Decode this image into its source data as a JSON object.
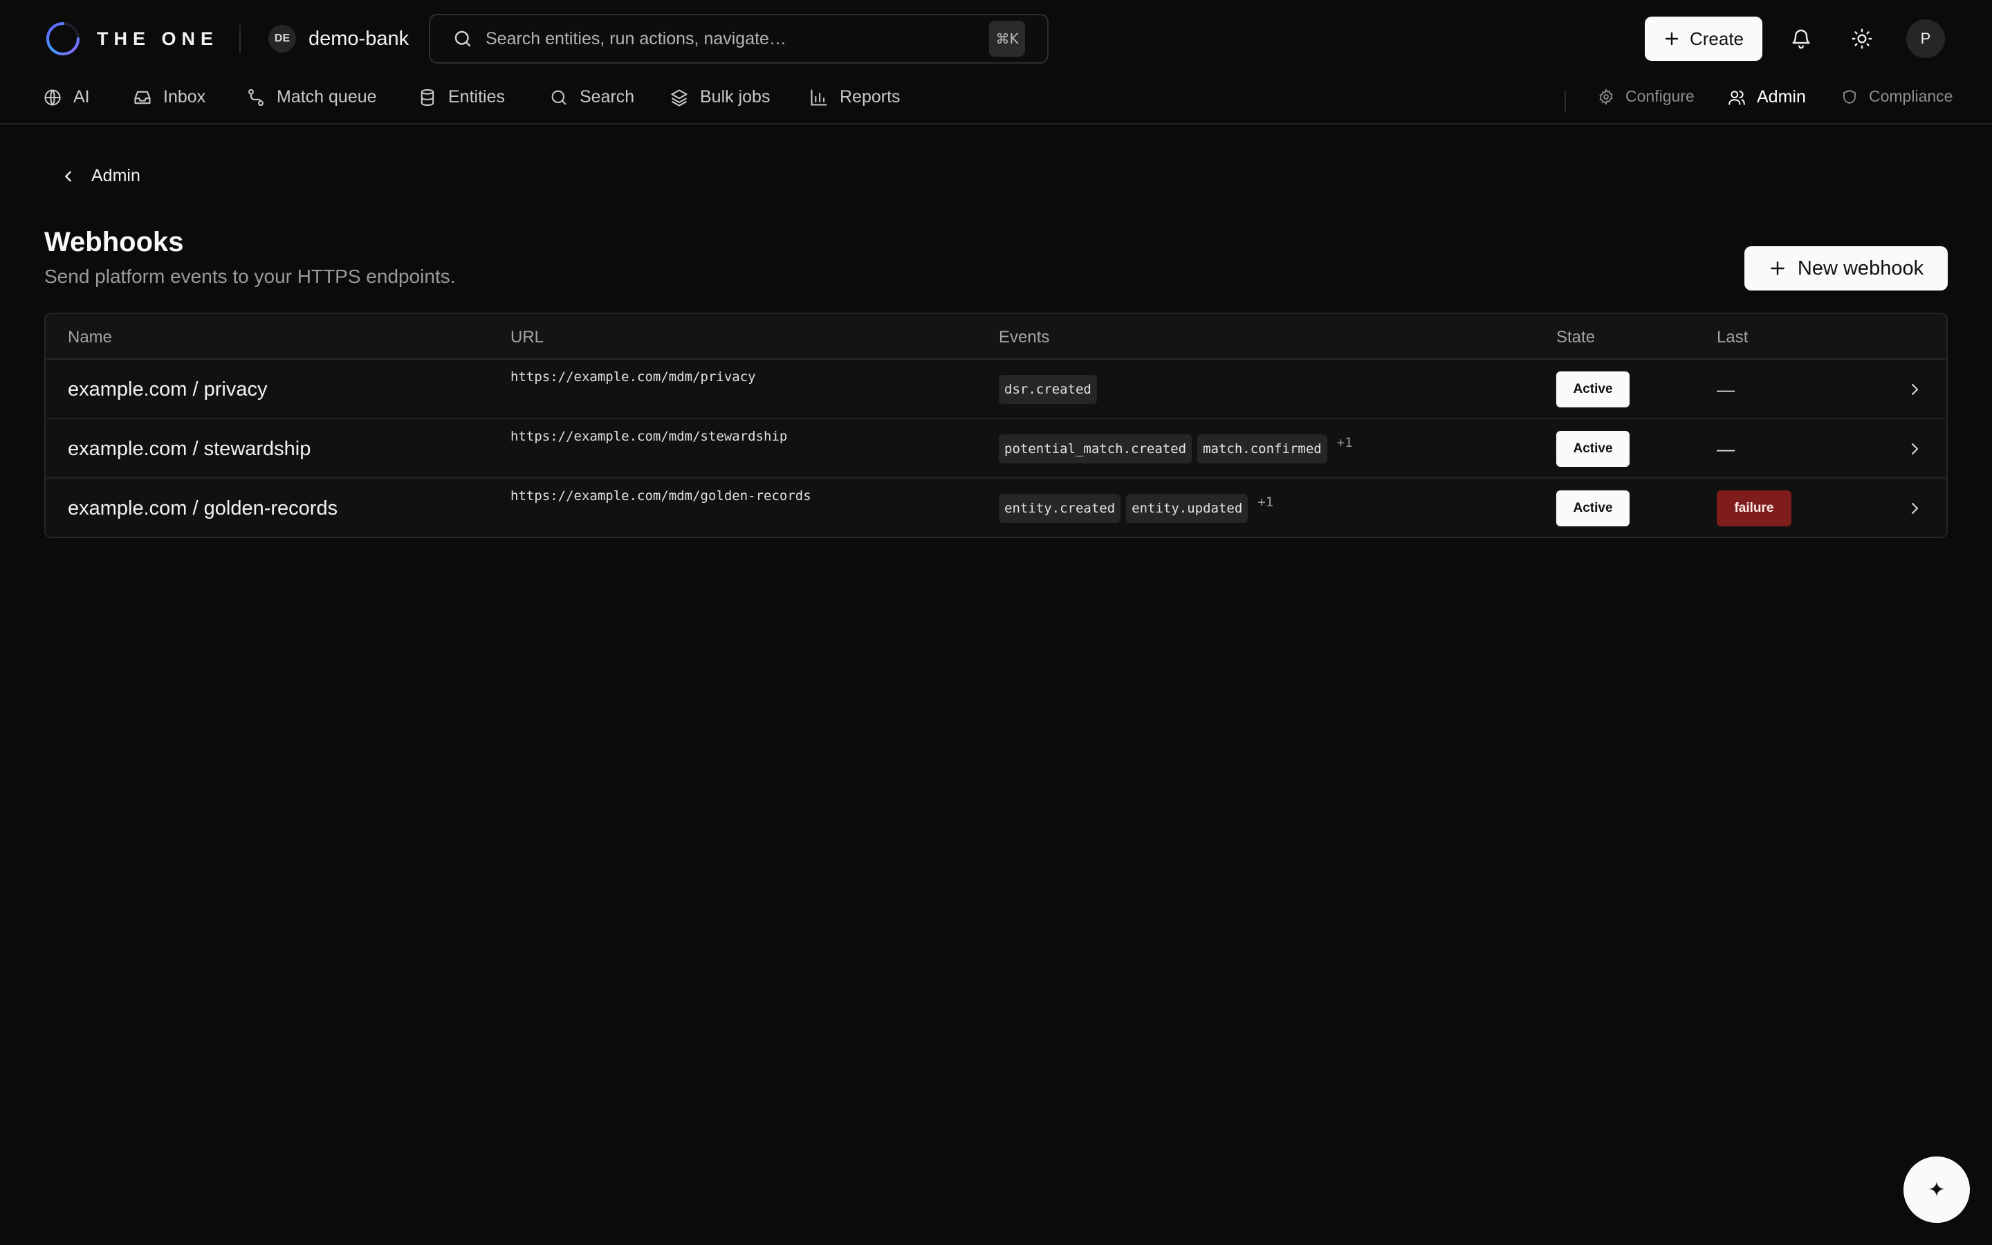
{
  "brand": {
    "name": "THE ONE"
  },
  "workspace": {
    "badge": "DE",
    "name": "demo-bank"
  },
  "command_search": {
    "placeholder": "Search entities, run actions, navigate…",
    "shortcut": "⌘K"
  },
  "top_actions": {
    "create_label": "Create",
    "avatar_initial": "P"
  },
  "nav": {
    "primary": [
      {
        "label": "AI",
        "icon": "globe-icon"
      },
      {
        "label": "Inbox",
        "icon": "inbox-icon"
      },
      {
        "label": "Match queue",
        "icon": "route-icon"
      },
      {
        "label": "Entities",
        "icon": "database-icon"
      },
      {
        "label": "Search",
        "icon": "search-icon"
      },
      {
        "label": "Bulk jobs",
        "icon": "layers-icon"
      },
      {
        "label": "Reports",
        "icon": "bar-chart-icon"
      }
    ],
    "secondary": [
      {
        "label": "Configure",
        "icon": "gear-icon"
      },
      {
        "label": "Admin",
        "icon": "users-icon",
        "active": true
      },
      {
        "label": "Compliance",
        "icon": "shield-icon"
      }
    ]
  },
  "breadcrumb": {
    "back_label": "Admin"
  },
  "page": {
    "title": "Webhooks",
    "subtitle": "Send platform events to your HTTPS endpoints.",
    "new_button_label": "New webhook"
  },
  "table": {
    "columns": [
      "Name",
      "URL",
      "Events",
      "State",
      "Last"
    ],
    "rows": [
      {
        "name": "example.com / privacy",
        "url": "https://example.com/mdm/privacy",
        "events": [
          "dsr.created"
        ],
        "more": "",
        "state": "Active",
        "last": "—"
      },
      {
        "name": "example.com / stewardship",
        "url": "https://example.com/mdm/stewardship",
        "events": [
          "potential_match.created",
          "match.confirmed"
        ],
        "more": "+1",
        "state": "Active",
        "last": "—"
      },
      {
        "name": "example.com / golden-records",
        "url": "https://example.com/mdm/golden-records",
        "events": [
          "entity.created",
          "entity.updated"
        ],
        "more": "+1",
        "state": "Active",
        "last": "failure"
      }
    ]
  },
  "fab": {
    "icon": "sparkle-icon",
    "glyph": "✦"
  },
  "colors": {
    "background": "#0b0b0b",
    "failure": "#7f1d1d",
    "primary_button": "#fafafa"
  }
}
